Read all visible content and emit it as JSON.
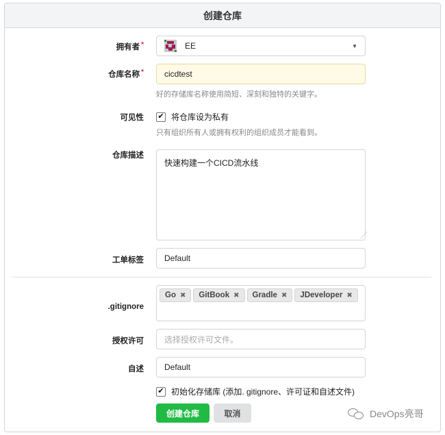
{
  "header": {
    "title": "创建仓库"
  },
  "owner": {
    "label": "拥有者",
    "value": "EE"
  },
  "repo_name": {
    "label": "仓库名称",
    "value": "cicdtest",
    "help": "好的存储库名称使用简短、深刻和独特的关键字。"
  },
  "visibility": {
    "label": "可见性",
    "checkbox_label": "将仓库设为私有",
    "checked": true,
    "help": "只有组织所有人或拥有权利的组织成员才能看到。"
  },
  "description": {
    "label": "仓库描述",
    "value": "快速构建一个CICD流水线"
  },
  "issue_labels": {
    "label": "工单标签",
    "value": "Default"
  },
  "gitignore": {
    "label": ".gitignore",
    "tags": [
      "Go",
      "GitBook",
      "Gradle",
      "JDeveloper"
    ]
  },
  "license": {
    "label": "授权许可",
    "placeholder": "选择授权许可文件。"
  },
  "readme": {
    "label": "自述",
    "value": "Default"
  },
  "auto_init": {
    "checkbox_label": "初始化存储库 (添加. gitignore、许可证和自述文件)",
    "checked": true
  },
  "buttons": {
    "create": "创建仓库",
    "cancel": "取消"
  },
  "watermark": {
    "text": "DevOps亮哥",
    "icon": "wechat-icon"
  }
}
